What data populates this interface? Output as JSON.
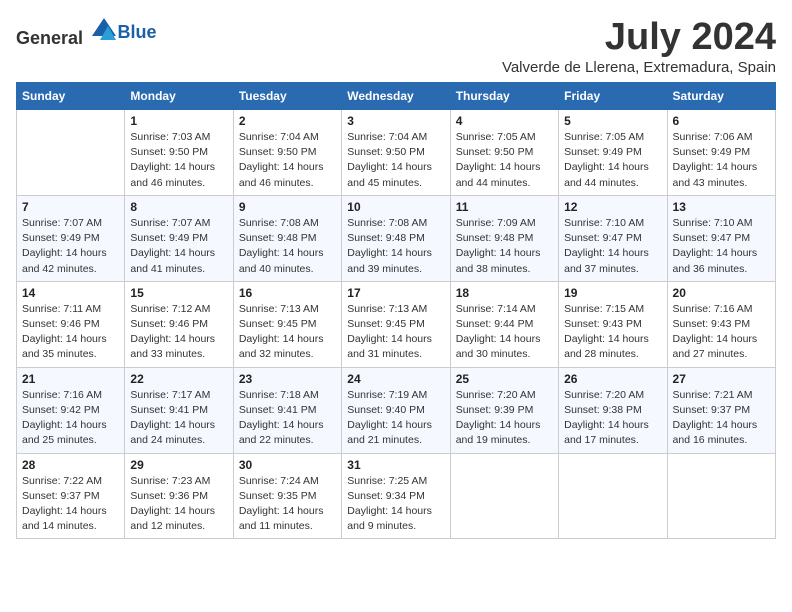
{
  "header": {
    "logo_general": "General",
    "logo_blue": "Blue",
    "month_year": "July 2024",
    "location": "Valverde de Llerena, Extremadura, Spain"
  },
  "weekdays": [
    "Sunday",
    "Monday",
    "Tuesday",
    "Wednesday",
    "Thursday",
    "Friday",
    "Saturday"
  ],
  "weeks": [
    [
      {
        "day": "",
        "info": ""
      },
      {
        "day": "1",
        "info": "Sunrise: 7:03 AM\nSunset: 9:50 PM\nDaylight: 14 hours\nand 46 minutes."
      },
      {
        "day": "2",
        "info": "Sunrise: 7:04 AM\nSunset: 9:50 PM\nDaylight: 14 hours\nand 46 minutes."
      },
      {
        "day": "3",
        "info": "Sunrise: 7:04 AM\nSunset: 9:50 PM\nDaylight: 14 hours\nand 45 minutes."
      },
      {
        "day": "4",
        "info": "Sunrise: 7:05 AM\nSunset: 9:50 PM\nDaylight: 14 hours\nand 44 minutes."
      },
      {
        "day": "5",
        "info": "Sunrise: 7:05 AM\nSunset: 9:49 PM\nDaylight: 14 hours\nand 44 minutes."
      },
      {
        "day": "6",
        "info": "Sunrise: 7:06 AM\nSunset: 9:49 PM\nDaylight: 14 hours\nand 43 minutes."
      }
    ],
    [
      {
        "day": "7",
        "info": "Sunrise: 7:07 AM\nSunset: 9:49 PM\nDaylight: 14 hours\nand 42 minutes."
      },
      {
        "day": "8",
        "info": "Sunrise: 7:07 AM\nSunset: 9:49 PM\nDaylight: 14 hours\nand 41 minutes."
      },
      {
        "day": "9",
        "info": "Sunrise: 7:08 AM\nSunset: 9:48 PM\nDaylight: 14 hours\nand 40 minutes."
      },
      {
        "day": "10",
        "info": "Sunrise: 7:08 AM\nSunset: 9:48 PM\nDaylight: 14 hours\nand 39 minutes."
      },
      {
        "day": "11",
        "info": "Sunrise: 7:09 AM\nSunset: 9:48 PM\nDaylight: 14 hours\nand 38 minutes."
      },
      {
        "day": "12",
        "info": "Sunrise: 7:10 AM\nSunset: 9:47 PM\nDaylight: 14 hours\nand 37 minutes."
      },
      {
        "day": "13",
        "info": "Sunrise: 7:10 AM\nSunset: 9:47 PM\nDaylight: 14 hours\nand 36 minutes."
      }
    ],
    [
      {
        "day": "14",
        "info": "Sunrise: 7:11 AM\nSunset: 9:46 PM\nDaylight: 14 hours\nand 35 minutes."
      },
      {
        "day": "15",
        "info": "Sunrise: 7:12 AM\nSunset: 9:46 PM\nDaylight: 14 hours\nand 33 minutes."
      },
      {
        "day": "16",
        "info": "Sunrise: 7:13 AM\nSunset: 9:45 PM\nDaylight: 14 hours\nand 32 minutes."
      },
      {
        "day": "17",
        "info": "Sunrise: 7:13 AM\nSunset: 9:45 PM\nDaylight: 14 hours\nand 31 minutes."
      },
      {
        "day": "18",
        "info": "Sunrise: 7:14 AM\nSunset: 9:44 PM\nDaylight: 14 hours\nand 30 minutes."
      },
      {
        "day": "19",
        "info": "Sunrise: 7:15 AM\nSunset: 9:43 PM\nDaylight: 14 hours\nand 28 minutes."
      },
      {
        "day": "20",
        "info": "Sunrise: 7:16 AM\nSunset: 9:43 PM\nDaylight: 14 hours\nand 27 minutes."
      }
    ],
    [
      {
        "day": "21",
        "info": "Sunrise: 7:16 AM\nSunset: 9:42 PM\nDaylight: 14 hours\nand 25 minutes."
      },
      {
        "day": "22",
        "info": "Sunrise: 7:17 AM\nSunset: 9:41 PM\nDaylight: 14 hours\nand 24 minutes."
      },
      {
        "day": "23",
        "info": "Sunrise: 7:18 AM\nSunset: 9:41 PM\nDaylight: 14 hours\nand 22 minutes."
      },
      {
        "day": "24",
        "info": "Sunrise: 7:19 AM\nSunset: 9:40 PM\nDaylight: 14 hours\nand 21 minutes."
      },
      {
        "day": "25",
        "info": "Sunrise: 7:20 AM\nSunset: 9:39 PM\nDaylight: 14 hours\nand 19 minutes."
      },
      {
        "day": "26",
        "info": "Sunrise: 7:20 AM\nSunset: 9:38 PM\nDaylight: 14 hours\nand 17 minutes."
      },
      {
        "day": "27",
        "info": "Sunrise: 7:21 AM\nSunset: 9:37 PM\nDaylight: 14 hours\nand 16 minutes."
      }
    ],
    [
      {
        "day": "28",
        "info": "Sunrise: 7:22 AM\nSunset: 9:37 PM\nDaylight: 14 hours\nand 14 minutes."
      },
      {
        "day": "29",
        "info": "Sunrise: 7:23 AM\nSunset: 9:36 PM\nDaylight: 14 hours\nand 12 minutes."
      },
      {
        "day": "30",
        "info": "Sunrise: 7:24 AM\nSunset: 9:35 PM\nDaylight: 14 hours\nand 11 minutes."
      },
      {
        "day": "31",
        "info": "Sunrise: 7:25 AM\nSunset: 9:34 PM\nDaylight: 14 hours\nand 9 minutes."
      },
      {
        "day": "",
        "info": ""
      },
      {
        "day": "",
        "info": ""
      },
      {
        "day": "",
        "info": ""
      }
    ]
  ]
}
